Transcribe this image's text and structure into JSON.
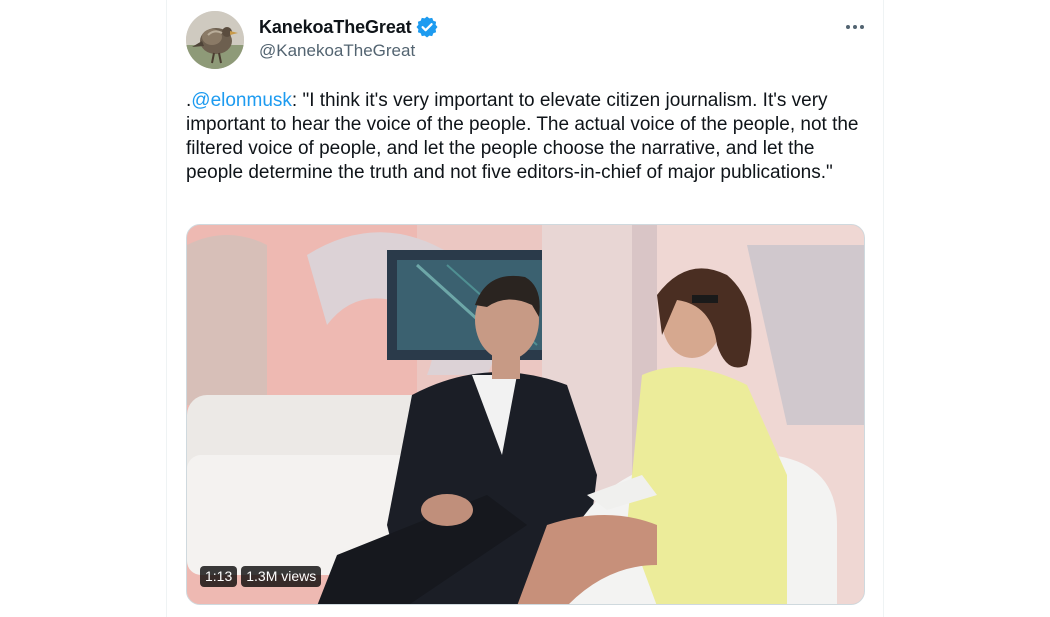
{
  "author": {
    "display_name": "KanekoaTheGreat",
    "handle": "@KanekoaTheGreat",
    "verified": true,
    "avatar_icon": "avatar-bird-photo"
  },
  "tweet": {
    "prefix": ".",
    "mention": "@elonmusk",
    "body": ": \"I think it's very important to elevate citizen journalism. It's very important to hear the voice of the people. The actual voice of the people, not the filtered voice of people, and let the people choose the narrative, and let the people determine the truth and not five editors-in-chief of major publications.\""
  },
  "media": {
    "duration": "1:13",
    "views": "1.3M views"
  },
  "icons": {
    "verified": "verified-badge-icon",
    "more": "more-options-icon"
  },
  "colors": {
    "accent": "#1d9bf0",
    "text": "#0f1419",
    "secondary_text": "#536471",
    "border": "#cfd9de"
  }
}
